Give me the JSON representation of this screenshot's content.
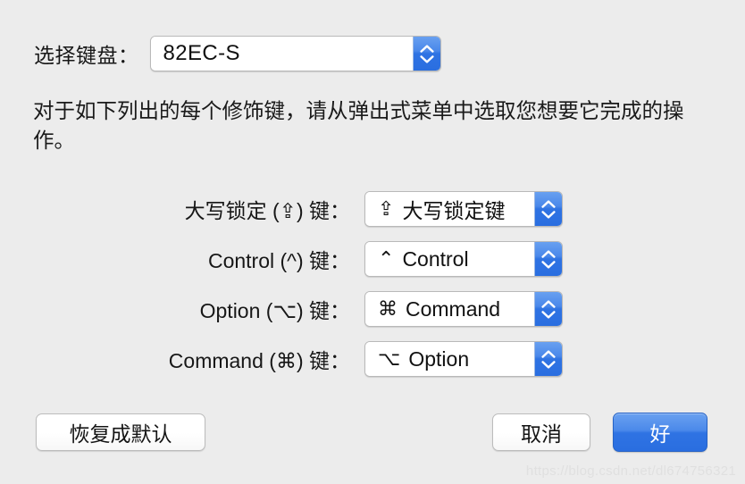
{
  "dialog": {
    "background_color": "#ececec",
    "accent_color": "#2f73e3"
  },
  "keyboard_selector": {
    "label": "选择键盘：",
    "value": "82EC-S",
    "stepper_icon": "stepper-up-down-icon"
  },
  "description": "对于如下列出的每个修饰键，请从弹出式菜单中选取您想要它完成的操作。",
  "modifiers": [
    {
      "label": "大写锁定 (⇪) 键：",
      "value_glyph": "⇪",
      "value_text": "大写锁定键",
      "name": "caps-lock"
    },
    {
      "label": "Control (^) 键：",
      "value_glyph": "⌃",
      "value_text": "Control",
      "name": "control"
    },
    {
      "label": "Option (⌥) 键：",
      "value_glyph": "⌘",
      "value_text": "Command",
      "name": "option"
    },
    {
      "label": "Command (⌘) 键：",
      "value_glyph": "⌥",
      "value_text": "Option",
      "name": "command"
    }
  ],
  "buttons": {
    "restore_defaults": "恢复成默认",
    "cancel": "取消",
    "ok": "好"
  },
  "watermark": "https://blog.csdn.net/dl674756321"
}
